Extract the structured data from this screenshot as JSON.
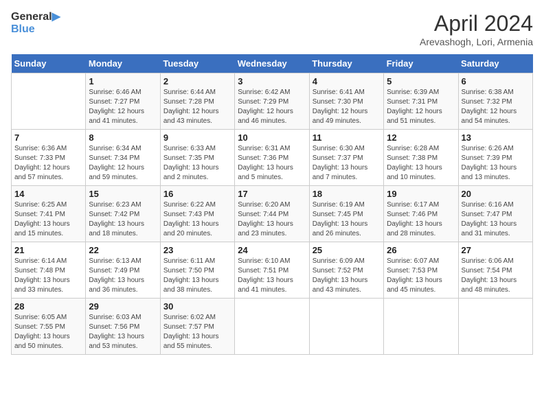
{
  "logo": {
    "line1": "General",
    "line2": "Blue"
  },
  "title": "April 2024",
  "subtitle": "Arevashogh, Lori, Armenia",
  "weekdays": [
    "Sunday",
    "Monday",
    "Tuesday",
    "Wednesday",
    "Thursday",
    "Friday",
    "Saturday"
  ],
  "weeks": [
    [
      {
        "day": "",
        "info": ""
      },
      {
        "day": "1",
        "info": "Sunrise: 6:46 AM\nSunset: 7:27 PM\nDaylight: 12 hours\nand 41 minutes."
      },
      {
        "day": "2",
        "info": "Sunrise: 6:44 AM\nSunset: 7:28 PM\nDaylight: 12 hours\nand 43 minutes."
      },
      {
        "day": "3",
        "info": "Sunrise: 6:42 AM\nSunset: 7:29 PM\nDaylight: 12 hours\nand 46 minutes."
      },
      {
        "day": "4",
        "info": "Sunrise: 6:41 AM\nSunset: 7:30 PM\nDaylight: 12 hours\nand 49 minutes."
      },
      {
        "day": "5",
        "info": "Sunrise: 6:39 AM\nSunset: 7:31 PM\nDaylight: 12 hours\nand 51 minutes."
      },
      {
        "day": "6",
        "info": "Sunrise: 6:38 AM\nSunset: 7:32 PM\nDaylight: 12 hours\nand 54 minutes."
      }
    ],
    [
      {
        "day": "7",
        "info": "Sunrise: 6:36 AM\nSunset: 7:33 PM\nDaylight: 12 hours\nand 57 minutes."
      },
      {
        "day": "8",
        "info": "Sunrise: 6:34 AM\nSunset: 7:34 PM\nDaylight: 12 hours\nand 59 minutes."
      },
      {
        "day": "9",
        "info": "Sunrise: 6:33 AM\nSunset: 7:35 PM\nDaylight: 13 hours\nand 2 minutes."
      },
      {
        "day": "10",
        "info": "Sunrise: 6:31 AM\nSunset: 7:36 PM\nDaylight: 13 hours\nand 5 minutes."
      },
      {
        "day": "11",
        "info": "Sunrise: 6:30 AM\nSunset: 7:37 PM\nDaylight: 13 hours\nand 7 minutes."
      },
      {
        "day": "12",
        "info": "Sunrise: 6:28 AM\nSunset: 7:38 PM\nDaylight: 13 hours\nand 10 minutes."
      },
      {
        "day": "13",
        "info": "Sunrise: 6:26 AM\nSunset: 7:39 PM\nDaylight: 13 hours\nand 13 minutes."
      }
    ],
    [
      {
        "day": "14",
        "info": "Sunrise: 6:25 AM\nSunset: 7:41 PM\nDaylight: 13 hours\nand 15 minutes."
      },
      {
        "day": "15",
        "info": "Sunrise: 6:23 AM\nSunset: 7:42 PM\nDaylight: 13 hours\nand 18 minutes."
      },
      {
        "day": "16",
        "info": "Sunrise: 6:22 AM\nSunset: 7:43 PM\nDaylight: 13 hours\nand 20 minutes."
      },
      {
        "day": "17",
        "info": "Sunrise: 6:20 AM\nSunset: 7:44 PM\nDaylight: 13 hours\nand 23 minutes."
      },
      {
        "day": "18",
        "info": "Sunrise: 6:19 AM\nSunset: 7:45 PM\nDaylight: 13 hours\nand 26 minutes."
      },
      {
        "day": "19",
        "info": "Sunrise: 6:17 AM\nSunset: 7:46 PM\nDaylight: 13 hours\nand 28 minutes."
      },
      {
        "day": "20",
        "info": "Sunrise: 6:16 AM\nSunset: 7:47 PM\nDaylight: 13 hours\nand 31 minutes."
      }
    ],
    [
      {
        "day": "21",
        "info": "Sunrise: 6:14 AM\nSunset: 7:48 PM\nDaylight: 13 hours\nand 33 minutes."
      },
      {
        "day": "22",
        "info": "Sunrise: 6:13 AM\nSunset: 7:49 PM\nDaylight: 13 hours\nand 36 minutes."
      },
      {
        "day": "23",
        "info": "Sunrise: 6:11 AM\nSunset: 7:50 PM\nDaylight: 13 hours\nand 38 minutes."
      },
      {
        "day": "24",
        "info": "Sunrise: 6:10 AM\nSunset: 7:51 PM\nDaylight: 13 hours\nand 41 minutes."
      },
      {
        "day": "25",
        "info": "Sunrise: 6:09 AM\nSunset: 7:52 PM\nDaylight: 13 hours\nand 43 minutes."
      },
      {
        "day": "26",
        "info": "Sunrise: 6:07 AM\nSunset: 7:53 PM\nDaylight: 13 hours\nand 45 minutes."
      },
      {
        "day": "27",
        "info": "Sunrise: 6:06 AM\nSunset: 7:54 PM\nDaylight: 13 hours\nand 48 minutes."
      }
    ],
    [
      {
        "day": "28",
        "info": "Sunrise: 6:05 AM\nSunset: 7:55 PM\nDaylight: 13 hours\nand 50 minutes."
      },
      {
        "day": "29",
        "info": "Sunrise: 6:03 AM\nSunset: 7:56 PM\nDaylight: 13 hours\nand 53 minutes."
      },
      {
        "day": "30",
        "info": "Sunrise: 6:02 AM\nSunset: 7:57 PM\nDaylight: 13 hours\nand 55 minutes."
      },
      {
        "day": "",
        "info": ""
      },
      {
        "day": "",
        "info": ""
      },
      {
        "day": "",
        "info": ""
      },
      {
        "day": "",
        "info": ""
      }
    ]
  ]
}
